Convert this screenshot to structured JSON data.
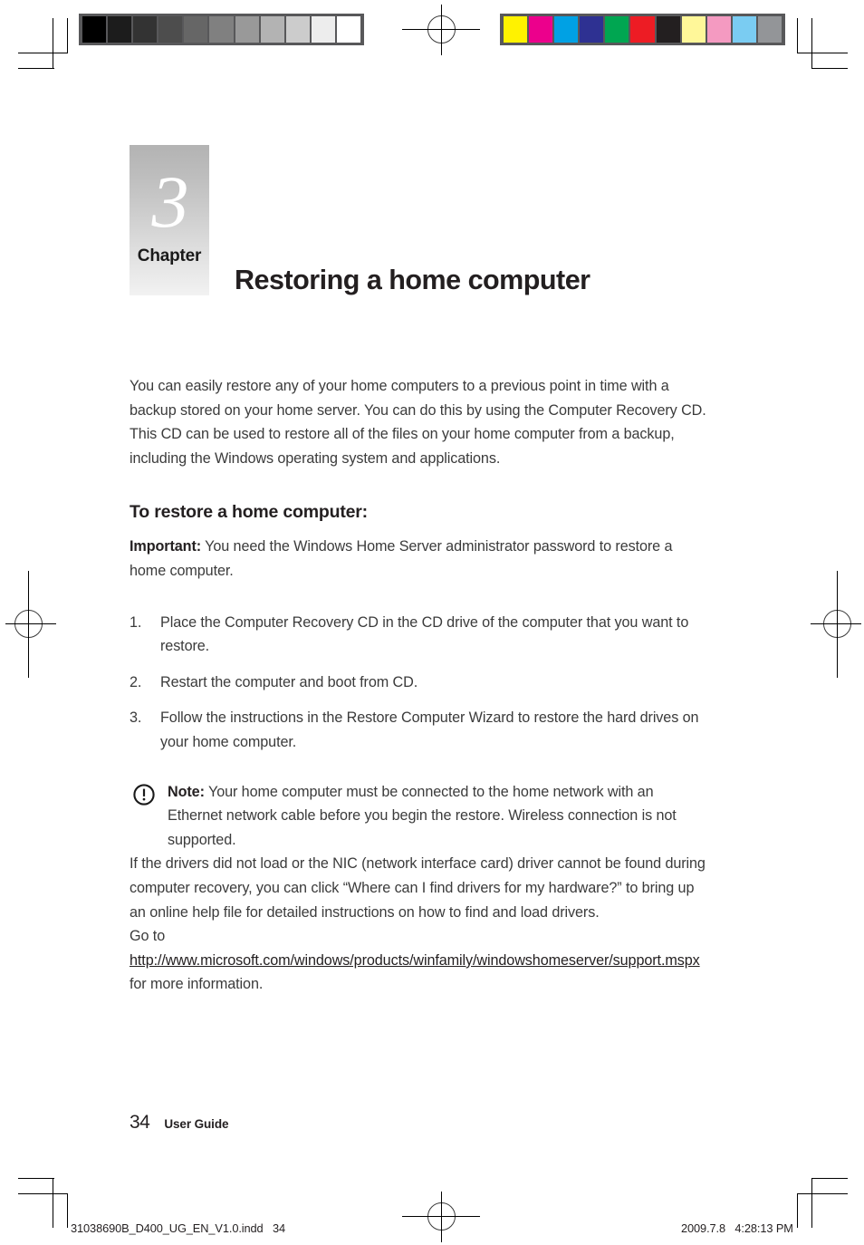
{
  "document": {
    "page_number": "34",
    "guide_label": "User Guide"
  },
  "chapter": {
    "number": "3",
    "word": "Chapter",
    "title": "Restoring a home computer"
  },
  "intro": {
    "text": "You can easily restore any of your home computers to a previous point in time with a backup stored on your home server. You can do this by using the Computer Recovery CD. This CD can be used to restore all of the files on your home computer from a backup, including the Windows operating system and applications."
  },
  "section": {
    "heading": "To restore a home computer:",
    "important_label": "Important:",
    "important_text": " You need the Windows Home Server administrator password to restore a home computer."
  },
  "steps": [
    {
      "num": "1.",
      "text": "Place the Computer Recovery CD in the CD drive of the computer that you want to restore."
    },
    {
      "num": "2.",
      "text": "Restart the computer and boot from CD."
    },
    {
      "num": "3.",
      "text": "Follow the instructions in the Restore Computer Wizard to restore the hard drives on your home computer."
    }
  ],
  "note": {
    "icon": "exclamation-circle-icon",
    "label": "Note:",
    "text": " Your home computer must be connected to the home network with an Ethernet network cable before you begin the restore. Wireless connection is not supported."
  },
  "drivers_para": {
    "text": "If the drivers did not load or the NIC (network interface card) driver cannot be found during computer recovery, you can click “Where can I find drivers for my hardware?” to bring up an online help file for detailed instructions on how to find and load drivers."
  },
  "link_para": {
    "prefix": "Go to ",
    "url_text": "http://www.microsoft.com/windows/products/winfamily/windowshomeserver/support.mspx",
    "suffix": " for more information."
  },
  "print_marks": {
    "file_label": "31038690B_D400_UG_EN_V1.0.indd   34",
    "timestamp": "2009.7.8   4:28:13 PM",
    "grayscale_swatches": [
      "#000000",
      "#1c1c1c",
      "#333333",
      "#4d4d4d",
      "#666666",
      "#808080",
      "#999999",
      "#b3b3b3",
      "#cccccc",
      "#ededed",
      "#ffffff"
    ],
    "color_swatches": [
      "#fff200",
      "#ec008c",
      "#00a1e4",
      "#2e3192",
      "#00a651",
      "#ed1c24",
      "#231f20",
      "#fff799",
      "#f49ac1",
      "#7accf2",
      "#939598"
    ]
  }
}
